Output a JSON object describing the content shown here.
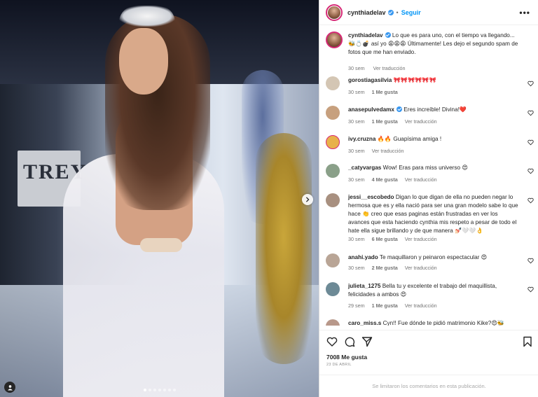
{
  "post": {
    "username": "cynthiadelav",
    "follow_label": "Seguir",
    "separator": "•",
    "more_label": "•••",
    "caption": "Lo que es para uno, con el tiempo va llegando...🐝💍💣 así yo 😩😩😩 Últimamente! Les dejo el segundo spam de fotos que me han enviado.",
    "caption_time": "30 sem",
    "caption_translate": "Ver traducción",
    "likes": "7008 Me gusta",
    "date": "23 de abril",
    "comments_limited": "Se limitaron los comentarios en esta publicación.",
    "carousel_dots": 7
  },
  "media": {
    "banner_text": "TREY"
  },
  "comments": [
    {
      "user": "gorostiagasilvia",
      "text": "🎀🎀🎀🎀🎀🎀",
      "time": "30 sem",
      "likes": "1 Me gusta",
      "translate": ""
    },
    {
      "user": "anasepulvedamx",
      "text": "Eres increíble! Divina!❤️",
      "time": "30 sem",
      "likes": "1 Me gusta",
      "translate": "Ver traducción"
    },
    {
      "user": "ivy.cruzna",
      "text": "🔥🔥 Guapísima amiga !",
      "time": "30 sem",
      "likes": "",
      "translate": "Ver traducción"
    },
    {
      "user": "_catyvargas",
      "text": "Wow! Eras para miss universo 😍",
      "time": "30 sem",
      "likes": "4 Me gusta",
      "translate": "Ver traducción"
    },
    {
      "user": "jessi__escobedo",
      "text": "Digan lo que digan de ella no pueden negar lo hermosa que es y ella nació para ser una gran modelo sabe lo que hace 👏 creo que esas paginas están frustradas en ver los avances que esta haciendo cynthia mis respeto a pesar de todo el hate ella sigue brillando y de que manera 💅🏻🤍🤍👌",
      "time": "30 sem",
      "likes": "6 Me gusta",
      "translate": "Ver traducción"
    },
    {
      "user": "anahi.yado",
      "text": "Te maquillaron y peinaron espectacular 😍",
      "time": "30 sem",
      "likes": "2 Me gusta",
      "translate": "Ver traducción"
    },
    {
      "user": "julieta_1275",
      "text": "Bella tu y excelente el trabajo del maquillista, felicidades a ambos 😍",
      "time": "29 sem",
      "likes": "1 Me gusta",
      "translate": "Ver traducción"
    },
    {
      "user": "caro_miss.s",
      "text": "Cyn!! Fue dónde te pidió matrimonio Kike?😍🐝",
      "time": "",
      "likes": "",
      "translate": ""
    }
  ]
}
